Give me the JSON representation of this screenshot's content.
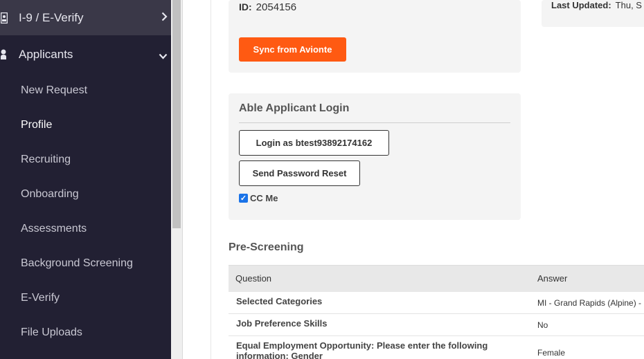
{
  "sidebar": {
    "i9": {
      "label": "I-9 / E-Verify",
      "icon": "id-card-icon",
      "chevron": "chevron-right-icon"
    },
    "applicants": {
      "label": "Applicants",
      "icon": "user-icon",
      "chevron": "chevron-down-icon"
    },
    "items": [
      {
        "label": "New Request"
      },
      {
        "label": "Profile",
        "active": true
      },
      {
        "label": "Recruiting"
      },
      {
        "label": "Onboarding"
      },
      {
        "label": "Assessments"
      },
      {
        "label": "Background Screening"
      },
      {
        "label": "E-Verify"
      },
      {
        "label": "File Uploads"
      }
    ]
  },
  "profile": {
    "id_label": "ID:",
    "id_value": "2054156",
    "sync_button": "Sync from Avionte",
    "last_updated_label": "Last Updated:",
    "last_updated_value": "Thu, S"
  },
  "login": {
    "title": "Able Applicant Login",
    "login_button": "Login as btest93892174162",
    "reset_button": "Send Password Reset",
    "cc_label": "CC Me",
    "cc_checked": true
  },
  "prescreening": {
    "title": "Pre-Screening",
    "columns": [
      "Question",
      "Answer"
    ],
    "rows": [
      {
        "question": "Selected Categories",
        "answer": "MI - Grand Rapids (Alpine) -"
      },
      {
        "question": "Job Preference Skills",
        "answer": "No"
      },
      {
        "question": "Equal Employment Opportunity: Please enter the following information: Gender",
        "answer": "Female"
      }
    ]
  },
  "colors": {
    "sidebar": "#222033",
    "accent": "#ff5a12",
    "panel": "#f4f4f4"
  }
}
